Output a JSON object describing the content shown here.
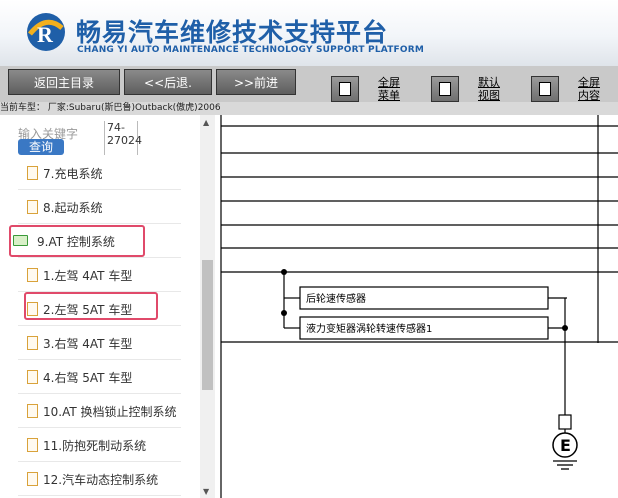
{
  "header": {
    "title": "畅易汽车维修技术支持平台",
    "subtitle": "CHANG YI AUTO MAINTENANCE TECHNOLOGY SUPPORT PLATFORM"
  },
  "toolbar": {
    "back_main": "返回主目录",
    "back": "<<后退.",
    "forward": ">>前进",
    "fullscreen_menu": [
      "全屏",
      "菜单"
    ],
    "default_view": [
      "默认",
      "视图"
    ],
    "fullscreen_content": [
      "全屏",
      "内容"
    ]
  },
  "car_info": "当前车型： 厂家:Subaru(斯巴鲁)Outback(傲虎)2006",
  "sidebar": {
    "search_placeholder": "输入关键字",
    "query_button": "查询",
    "code_line1": "74-",
    "code_line2": "27024",
    "items": [
      {
        "label": "7.充电系统",
        "icon": "document-icon"
      },
      {
        "label": "8.起动系统",
        "icon": "document-icon"
      },
      {
        "label": "9.AT 控制系统",
        "icon": "folder-open-icon"
      },
      {
        "label": "1.左驾 4AT 车型",
        "icon": "document-icon"
      },
      {
        "label": "2.左驾 5AT 车型",
        "icon": "document-icon"
      },
      {
        "label": "3.右驾 4AT 车型",
        "icon": "document-icon"
      },
      {
        "label": "4.右驾 5AT 车型",
        "icon": "document-icon"
      },
      {
        "label": "10.AT 换档锁止控制系统",
        "icon": "document-icon"
      },
      {
        "label": "11.防抱死制动系统",
        "icon": "document-icon"
      },
      {
        "label": "12.汽车动态控制系统",
        "icon": "document-icon"
      }
    ]
  },
  "diagram": {
    "sensor1": "后轮速传感器",
    "sensor2": "液力变矩器涡轮转速传感器1",
    "ground_label": "E"
  },
  "colors": {
    "title_blue": "#1f5fa8",
    "highlight_red": "#e04a6a",
    "query_blue": "#3a78c4"
  }
}
